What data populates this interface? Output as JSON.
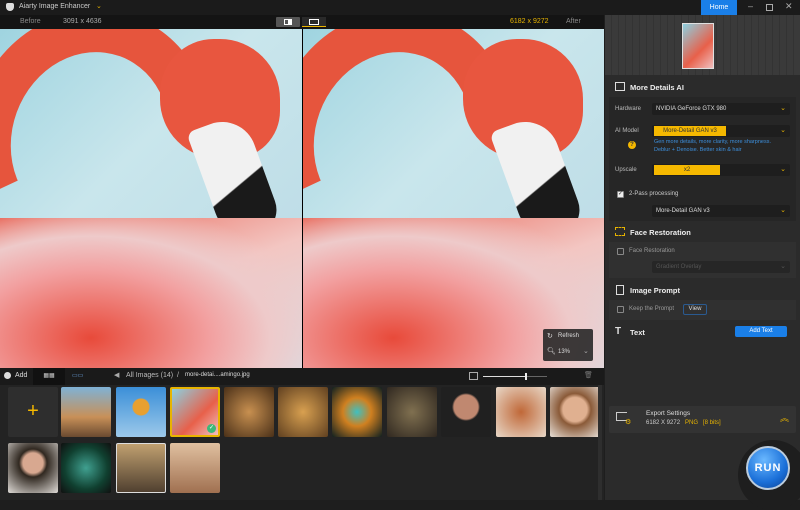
{
  "app": {
    "title": "Aiarty Image Enhancer",
    "home": "Home"
  },
  "toolbar": {
    "before": "Before",
    "before_size": "3091 x 4636",
    "after_size": "6182 x 9272",
    "after": "After"
  },
  "zoom": {
    "refresh": "Refresh",
    "level": "13%"
  },
  "bottombar": {
    "add": "Add",
    "breadcrumb_all": "All Images (14)",
    "separator": "/",
    "current_file": "more-detai....amingo.jpg",
    "thumb_size_slider": 0.65
  },
  "panel": {
    "more_details": {
      "title": "More Details AI",
      "hardware_label": "Hardware",
      "hardware": "NVIDIA GeForce GTX 980",
      "model_label": "AI Model",
      "model": "More-Detail GAN  v3",
      "model_desc_1": "Gen more details, more clarity, more sharpness.",
      "model_desc_2": "Deblur + Denoise. Better skin & hair",
      "upscale_label": "Upscale",
      "upscale": "x2",
      "two_pass_label": "2-Pass processing",
      "two_pass_checked": true,
      "two_pass_model": "More-Detail GAN  v3"
    },
    "face": {
      "title": "Face Restoration",
      "checkbox": "Face Restoration",
      "option": "Gradient Overlay"
    },
    "prompt": {
      "title": "Image Prompt",
      "checkbox": "Keep the Prompt",
      "view": "View"
    },
    "text": {
      "title": "Text",
      "add": "Add Text"
    },
    "export": {
      "title": "Export Settings",
      "size": "6182 X 9272",
      "format": "PNG",
      "bits": "[8 bits]"
    },
    "run": "RUN"
  },
  "colors": {
    "accent": "#f5b800",
    "blue": "#1a7fe8"
  }
}
